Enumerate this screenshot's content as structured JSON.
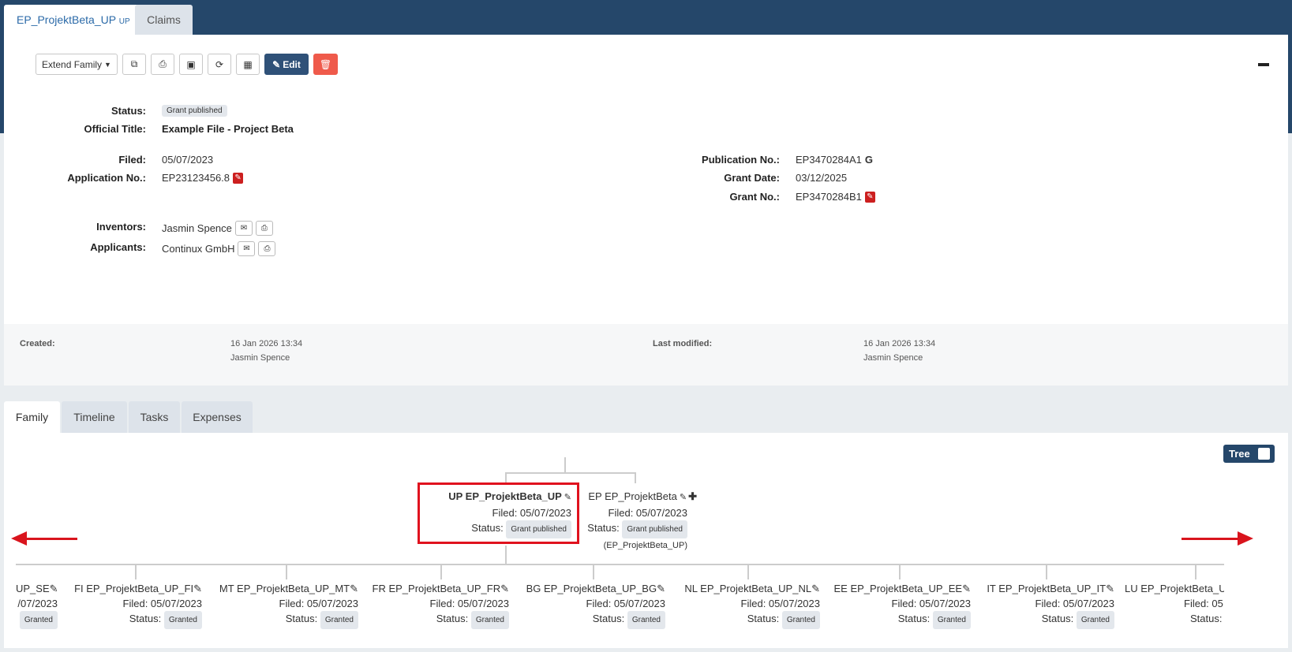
{
  "tabs": {
    "main_label": "EP_ProjektBeta_UP",
    "main_suffix": "UP",
    "claims_label": "Claims"
  },
  "toolbar": {
    "extend_label": "Extend Family",
    "edit_label": "Edit",
    "icons": [
      "copy-icon",
      "print-icon",
      "archive-icon",
      "refresh-icon",
      "calculator-icon"
    ]
  },
  "details": {
    "status_label": "Status:",
    "status_value": "Grant published",
    "title_label": "Official Title:",
    "title_value": "Example File - Project Beta",
    "filed_label": "Filed:",
    "filed_value": "05/07/2023",
    "appno_label": "Application No.:",
    "appno_value": "EP23123456.8",
    "pubno_label": "Publication No.:",
    "pubno_value": "EP3470284A1",
    "grantdate_label": "Grant Date:",
    "grantdate_value": "03/12/2025",
    "grantno_label": "Grant No.:",
    "grantno_value": "EP3470284B1",
    "inventors_label": "Inventors:",
    "inventors_value": "Jasmin Spence",
    "applicants_label": "Applicants:",
    "applicants_value": "Continux GmbH"
  },
  "meta": {
    "created_label": "Created:",
    "created_date": "16 Jan 2026 13:34",
    "created_by": "Jasmin Spence",
    "modified_label": "Last modified:",
    "modified_date": "16 Jan 2026 13:34",
    "modified_by": "Jasmin Spence"
  },
  "bottom_tabs": [
    "Family",
    "Timeline",
    "Tasks",
    "Expenses"
  ],
  "tree_label": "Tree",
  "family": {
    "current": {
      "title": "UP EP_ProjektBeta_UP",
      "filed": "Filed: 05/07/2023",
      "status_label": "Status:",
      "status": "Grant published"
    },
    "parent": {
      "title": "EP EP_ProjektBeta",
      "filed": "Filed: 05/07/2023",
      "status_label": "Status:",
      "status": "Grant published",
      "note": "(EP_ProjektBeta_UP)"
    },
    "children": [
      {
        "title": "UP_SE",
        "filed": "/07/2023",
        "status_label": "",
        "status": "Granted"
      },
      {
        "title": "FI EP_ProjektBeta_UP_FI",
        "filed": "Filed: 05/07/2023",
        "status_label": "Status:",
        "status": "Granted"
      },
      {
        "title": "MT EP_ProjektBeta_UP_MT",
        "filed": "Filed: 05/07/2023",
        "status_label": "Status:",
        "status": "Granted"
      },
      {
        "title": "FR EP_ProjektBeta_UP_FR",
        "filed": "Filed: 05/07/2023",
        "status_label": "Status:",
        "status": "Granted"
      },
      {
        "title": "BG EP_ProjektBeta_UP_BG",
        "filed": "Filed: 05/07/2023",
        "status_label": "Status:",
        "status": "Granted"
      },
      {
        "title": "NL EP_ProjektBeta_UP_NL",
        "filed": "Filed: 05/07/2023",
        "status_label": "Status:",
        "status": "Granted"
      },
      {
        "title": "EE EP_ProjektBeta_UP_EE",
        "filed": "Filed: 05/07/2023",
        "status_label": "Status:",
        "status": "Granted"
      },
      {
        "title": "IT EP_ProjektBeta_UP_IT",
        "filed": "Filed: 05/07/2023",
        "status_label": "Status:",
        "status": "Granted"
      },
      {
        "title": "LU EP_ProjektBeta_U",
        "filed": "Filed: 05",
        "status_label": "Status:",
        "status": ""
      }
    ]
  },
  "colors": {
    "header": "#25476a",
    "edit": "#2f5178",
    "delete": "#ef5a4b",
    "highlight": "#e0121e"
  }
}
